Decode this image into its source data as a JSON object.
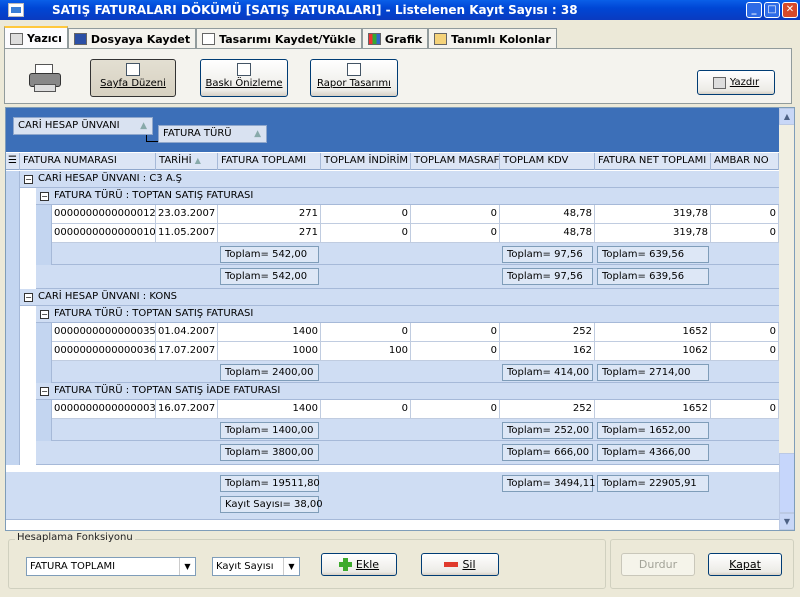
{
  "window": {
    "title": "SATIŞ FATURALARI DÖKÜMÜ [SATIŞ FATURALARI]  -  Listelenen Kayıt Sayısı : 38"
  },
  "tabs": [
    {
      "label": "Yazıcı"
    },
    {
      "label": "Dosyaya Kaydet"
    },
    {
      "label": "Tasarımı Kaydet/Yükle"
    },
    {
      "label": "Grafik"
    },
    {
      "label": "Tanımlı Kolonlar"
    }
  ],
  "toolbar": {
    "page_setup": "Sayfa Düzeni",
    "print_preview": "Baskı Önizleme",
    "report_design": "Rapor Tasarımı",
    "print": "Yazdır"
  },
  "group_panel": {
    "group1": "CARİ HESAP ÜNVANI",
    "group2": "FATURA TÜRÜ"
  },
  "columns": [
    "FATURA NUMARASI",
    "TARİHİ",
    "FATURA TOPLAMI",
    "TOPLAM İNDİRİM",
    "TOPLAM MASRAF",
    "TOPLAM KDV",
    "FATURA NET TOPLAMI",
    "AMBAR NO"
  ],
  "groups": [
    {
      "header": "CARİ HESAP ÜNVANI : C3 A.Ş",
      "subgroups": [
        {
          "header": "FATURA TÜRÜ : TOPTAN SATIŞ FATURASI",
          "rows": [
            [
              "0000000000000012",
              "23.03.2007",
              "271",
              "0",
              "0",
              "48,78",
              "319,78",
              "0"
            ],
            [
              "0000000000000010",
              "11.05.2007",
              "271",
              "0",
              "0",
              "48,78",
              "319,78",
              "0"
            ]
          ],
          "summary": {
            "total": "Toplam= 542,00",
            "kdv": "Toplam= 97,56",
            "net": "Toplam= 639,56"
          }
        }
      ],
      "summary": {
        "total": "Toplam= 542,00",
        "kdv": "Toplam= 97,56",
        "net": "Toplam= 639,56"
      }
    },
    {
      "header": "CARİ HESAP ÜNVANI : KONS",
      "subgroups": [
        {
          "header": "FATURA TÜRÜ : TOPTAN SATIŞ FATURASI",
          "rows": [
            [
              "0000000000000035",
              "01.04.2007",
              "1400",
              "0",
              "0",
              "252",
              "1652",
              "0"
            ],
            [
              "0000000000000036",
              "17.07.2007",
              "1000",
              "100",
              "0",
              "162",
              "1062",
              "0"
            ]
          ],
          "summary": {
            "total": "Toplam= 2400,00",
            "kdv": "Toplam= 414,00",
            "net": "Toplam= 2714,00"
          }
        },
        {
          "header": "FATURA TÜRÜ : TOPTAN SATIŞ İADE FATURASI",
          "rows": [
            [
              "0000000000000003",
              "16.07.2007",
              "1400",
              "0",
              "0",
              "252",
              "1652",
              "0"
            ]
          ],
          "summary": {
            "total": "Toplam= 1400,00",
            "kdv": "Toplam= 252,00",
            "net": "Toplam= 1652,00"
          }
        }
      ],
      "summary": {
        "total": "Toplam= 3800,00",
        "kdv": "Toplam= 666,00",
        "net": "Toplam= 4366,00"
      }
    }
  ],
  "footer": {
    "total": "Toplam= 19511,80",
    "kdv": "Toplam= 3494,11",
    "net": "Toplam= 22905,91",
    "count": "Kayıt Sayısı= 38,00"
  },
  "bottom": {
    "group_label": "Hesaplama Fonksiyonu",
    "field_select": "FATURA TOPLAMI",
    "func_select": "Kayıt Sayısı",
    "add": "Ekle",
    "delete": "Sil",
    "stop": "Durdur",
    "close": "Kapat"
  }
}
